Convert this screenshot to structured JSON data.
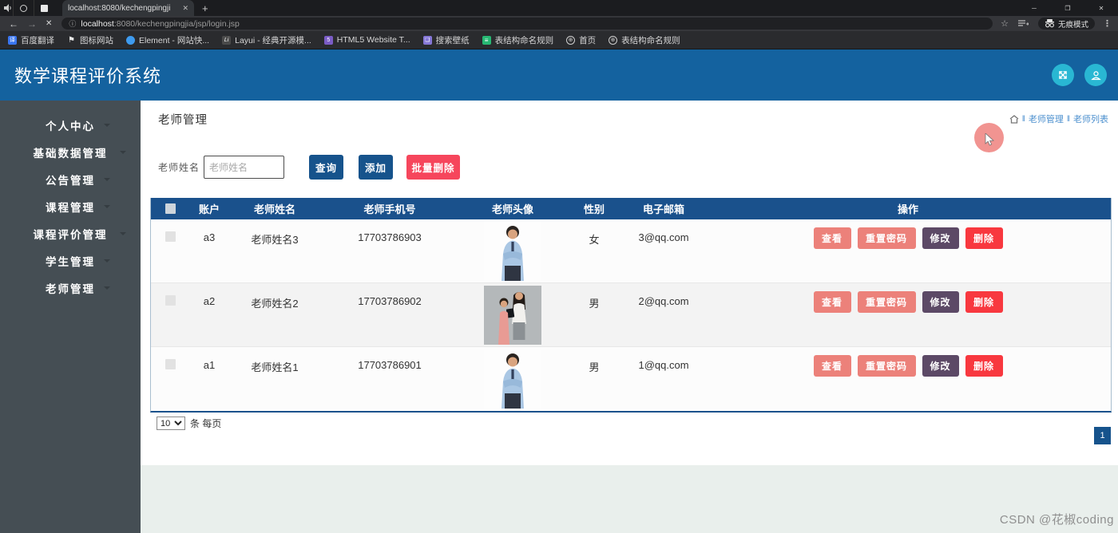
{
  "colors": {
    "app_header": "#14629f",
    "accent_cyan": "#29b7d3",
    "sidebar_bg": "#454e54",
    "table_header": "#1a518c",
    "primary_button": "#16538c",
    "batch_delete_button": "#f6465c",
    "action_salmon": "#ec817a",
    "action_purple": "#5c4966",
    "action_red": "#f8383f",
    "breadcrumb_link": "#4b8fce"
  },
  "browser": {
    "tab": {
      "title": "localhost:8080/kechengpingji",
      "close": "✕"
    },
    "new_tab": "+",
    "window_controls": {
      "minimize": "─",
      "restore": "❐",
      "close": "✕"
    },
    "nav": {
      "back": "←",
      "forward": "→",
      "stop": "✕"
    },
    "icons": {
      "info": "ⓘ",
      "star": "☆",
      "dots": "⋮"
    },
    "url": {
      "host": "localhost",
      "path": ":8080/kechengpingjia/jsp/login.jsp"
    },
    "incognito_label": "无痕模式",
    "bookmarks": [
      {
        "label": "百度翻译",
        "glyph": "译"
      },
      {
        "label": "图标网站",
        "glyph": "⚑"
      },
      {
        "label": "Element - 网站快...",
        "glyph": ""
      },
      {
        "label": "Layui - 经典开源模...",
        "glyph": "Li"
      },
      {
        "label": "HTML5 Website T...",
        "glyph": "5"
      },
      {
        "label": "搜索壁纸",
        "glyph": "❏"
      },
      {
        "label": "表结构命名规则",
        "glyph": "≡"
      },
      {
        "label": "首页",
        "glyph": "⊕"
      },
      {
        "label": "表结构命名规则",
        "glyph": "⊕"
      }
    ]
  },
  "app": {
    "title": "数学课程评价系统"
  },
  "sidebar": {
    "items": [
      {
        "label": "个人中心"
      },
      {
        "label": "基础数据管理"
      },
      {
        "label": "公告管理"
      },
      {
        "label": "课程管理"
      },
      {
        "label": "课程评价管理"
      },
      {
        "label": "学生管理"
      },
      {
        "label": "老师管理"
      }
    ]
  },
  "page": {
    "title": "老师管理",
    "breadcrumb": {
      "sep1": "‖",
      "crumb1": "老师管理",
      "sep2": "‖",
      "crumb2": "老师列表"
    },
    "search": {
      "label": "老师姓名",
      "placeholder": "老师姓名",
      "query": "查询",
      "add": "添加",
      "batch_delete": "批量删除"
    }
  },
  "table": {
    "headers": {
      "account": "账户",
      "name": "老师姓名",
      "phone": "老师手机号",
      "avatar": "老师头像",
      "gender": "性别",
      "email": "电子邮箱",
      "ops": "操作"
    },
    "actions": {
      "view": "查看",
      "reset_password": "重置密码",
      "edit": "修改",
      "delete": "删除"
    },
    "rows": [
      {
        "account": "a3",
        "name": "老师姓名3",
        "phone": "17703786903",
        "gender": "女",
        "email": "3@qq.com",
        "avatar": "man-blue-shirt"
      },
      {
        "account": "a2",
        "name": "老师姓名2",
        "phone": "17703786902",
        "gender": "男",
        "email": "2@qq.com",
        "avatar": "two-women"
      },
      {
        "account": "a1",
        "name": "老师姓名1",
        "phone": "17703786901",
        "gender": "男",
        "email": "1@qq.com",
        "avatar": "man-blue-shirt"
      }
    ]
  },
  "pagination": {
    "per_page": "10",
    "unit": "条 每页",
    "page_1": "1"
  },
  "watermark": "CSDN @花椒coding"
}
